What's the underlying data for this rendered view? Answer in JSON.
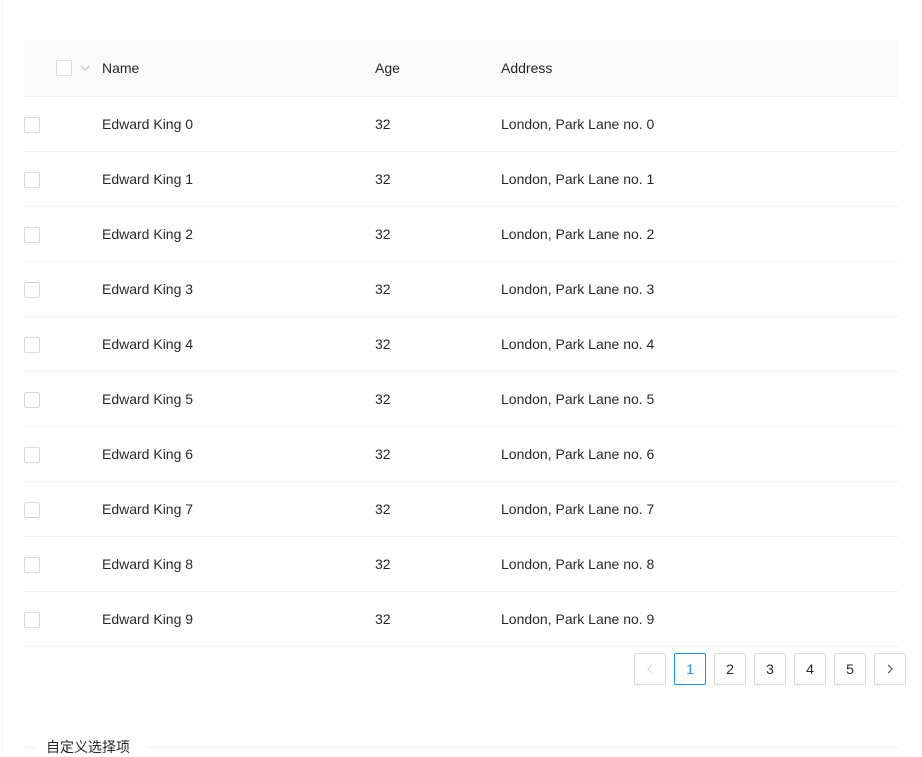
{
  "table": {
    "columns": [
      {
        "key": "selection",
        "label": ""
      },
      {
        "key": "name",
        "label": "Name"
      },
      {
        "key": "age",
        "label": "Age"
      },
      {
        "key": "address",
        "label": "Address"
      }
    ],
    "header": {
      "select_all_checkbox_checked": false,
      "select_all_dropdown_icon": "chevron-down-icon"
    },
    "rows": [
      {
        "selected": false,
        "name": "Edward King 0",
        "age": "32",
        "address": "London, Park Lane no. 0"
      },
      {
        "selected": false,
        "name": "Edward King 1",
        "age": "32",
        "address": "London, Park Lane no. 1"
      },
      {
        "selected": false,
        "name": "Edward King 2",
        "age": "32",
        "address": "London, Park Lane no. 2"
      },
      {
        "selected": false,
        "name": "Edward King 3",
        "age": "32",
        "address": "London, Park Lane no. 3"
      },
      {
        "selected": false,
        "name": "Edward King 4",
        "age": "32",
        "address": "London, Park Lane no. 4"
      },
      {
        "selected": false,
        "name": "Edward King 5",
        "age": "32",
        "address": "London, Park Lane no. 5"
      },
      {
        "selected": false,
        "name": "Edward King 6",
        "age": "32",
        "address": "London, Park Lane no. 6"
      },
      {
        "selected": false,
        "name": "Edward King 7",
        "age": "32",
        "address": "London, Park Lane no. 7"
      },
      {
        "selected": false,
        "name": "Edward King 8",
        "age": "32",
        "address": "London, Park Lane no. 8"
      },
      {
        "selected": false,
        "name": "Edward King 9",
        "age": "32",
        "address": "London, Park Lane no. 9"
      }
    ]
  },
  "pagination": {
    "prev_icon": "chevron-left-icon",
    "next_icon": "chevron-right-icon",
    "prev_disabled": true,
    "next_disabled": false,
    "current_page": 1,
    "pages": [
      "1",
      "2",
      "3",
      "4",
      "5"
    ]
  },
  "bottom_section": {
    "divider_text": "自定义选择项"
  },
  "colors": {
    "accent": "#1890ff",
    "header_bg": "#fafafa",
    "border": "#f0f0f0",
    "control_border": "#d9d9d9",
    "text": "rgba(0,0,0,0.85)",
    "text_disabled": "#d9d9d9"
  }
}
